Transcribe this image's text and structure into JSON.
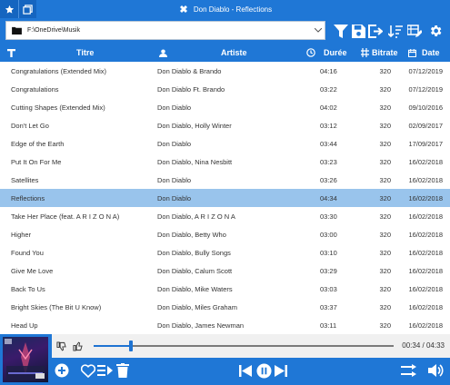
{
  "window": {
    "title": "Don Diablo - Reflections"
  },
  "toolbar": {
    "path": "F:\\OneDrive\\Musik"
  },
  "columns": {
    "title": "Titre",
    "artist": "Artiste",
    "duration": "Durée",
    "bitrate": "Bitrate",
    "date": "Date"
  },
  "tracks": [
    {
      "title": "Congratulations (Extended Mix)",
      "artist": "Don Diablo & Brando",
      "duration": "04:16",
      "bitrate": "320",
      "date": "07/12/2019"
    },
    {
      "title": "Congratulations",
      "artist": "Don Diablo Ft. Brando",
      "duration": "03:22",
      "bitrate": "320",
      "date": "07/12/2019"
    },
    {
      "title": "Cutting Shapes (Extended Mix)",
      "artist": "Don Diablo",
      "duration": "04:02",
      "bitrate": "320",
      "date": "09/10/2016"
    },
    {
      "title": "Don't Let Go",
      "artist": "Don Diablo, Holly Winter",
      "duration": "03:12",
      "bitrate": "320",
      "date": "02/09/2017"
    },
    {
      "title": "Edge of the Earth",
      "artist": "Don Diablo",
      "duration": "03:44",
      "bitrate": "320",
      "date": "17/09/2017"
    },
    {
      "title": "Put It On For Me",
      "artist": "Don Diablo, Nina Nesbitt",
      "duration": "03:23",
      "bitrate": "320",
      "date": "16/02/2018"
    },
    {
      "title": "Satellites",
      "artist": "Don Diablo",
      "duration": "03:26",
      "bitrate": "320",
      "date": "16/02/2018"
    },
    {
      "title": "Reflections",
      "artist": "Don Diablo",
      "duration": "04:34",
      "bitrate": "320",
      "date": "16/02/2018",
      "selected": true
    },
    {
      "title": "Take Her Place (feat. A R I Z O N A)",
      "artist": "Don Diablo, A R I Z O N A",
      "duration": "03:30",
      "bitrate": "320",
      "date": "16/02/2018"
    },
    {
      "title": "Higher",
      "artist": "Don Diablo, Betty Who",
      "duration": "03:00",
      "bitrate": "320",
      "date": "16/02/2018"
    },
    {
      "title": "Found You",
      "artist": "Don Diablo, Bully Songs",
      "duration": "03:10",
      "bitrate": "320",
      "date": "16/02/2018"
    },
    {
      "title": "Give Me Love",
      "artist": "Don Diablo, Calum Scott",
      "duration": "03:29",
      "bitrate": "320",
      "date": "16/02/2018"
    },
    {
      "title": "Back To Us",
      "artist": "Don Diablo, Mike Waters",
      "duration": "03:03",
      "bitrate": "320",
      "date": "16/02/2018"
    },
    {
      "title": "Bright Skies (The Bit U Know)",
      "artist": "Don Diablo, Miles Graham",
      "duration": "03:37",
      "bitrate": "320",
      "date": "16/02/2018"
    },
    {
      "title": "Head Up",
      "artist": "Don Diablo, James Newman",
      "duration": "03:11",
      "bitrate": "320",
      "date": "16/02/2018"
    }
  ],
  "player": {
    "time": "00:34 / 04:33",
    "progress_fraction": 0.125
  },
  "colors": {
    "accent": "#1f77d6",
    "selected_row": "#99c4ec",
    "icon": "#ffffff"
  }
}
